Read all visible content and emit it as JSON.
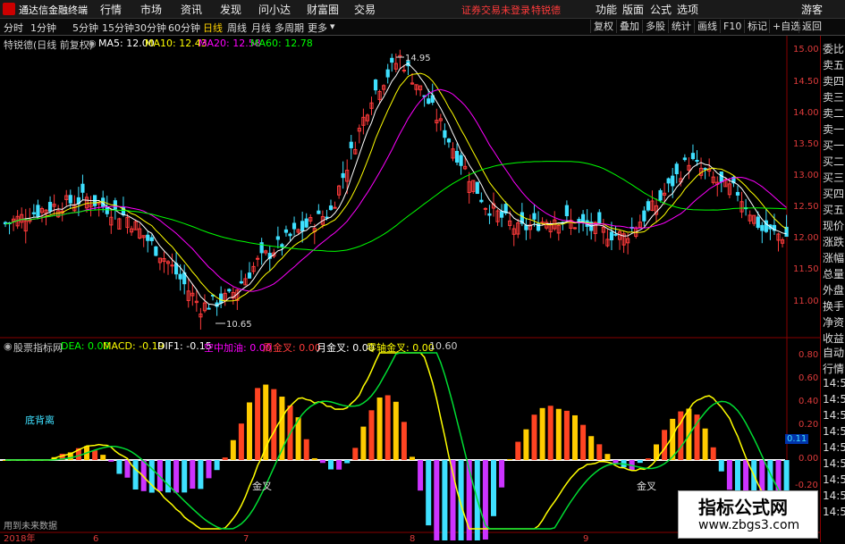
{
  "titlebar": {
    "app_name": "通达信金融终端",
    "menu": [
      "行情",
      "市场",
      "资讯",
      "发现",
      "问小达",
      "财富圈",
      "交易"
    ],
    "login_notice": "证券交易未登录",
    "stock_name": "特锐德",
    "right_menu": [
      "功能",
      "版面",
      "公式",
      "选项"
    ],
    "guest": "游客"
  },
  "tabbar": {
    "periods": [
      "分时",
      "1分钟",
      "5分钟",
      "15分钟",
      "30分钟",
      "60分钟",
      "日线",
      "周线",
      "月线",
      "多周期",
      "更多"
    ],
    "active": "日线",
    "right_buttons": [
      "复权",
      "叠加",
      "多股",
      "统计",
      "画线",
      "F10",
      "标记",
      "+自选",
      "返回"
    ]
  },
  "main_header": {
    "title": "特锐德(日线 前复权)",
    "ma5": "MA5: 12.00",
    "ma10": "MA10: 12.43",
    "ma20": "MA20: 12.58",
    "ma60": "MA60: 12.78"
  },
  "price_axis": [
    "15.00",
    "14.50",
    "14.00",
    "13.50",
    "13.00",
    "12.50",
    "12.00",
    "11.50",
    "11.00"
  ],
  "annotations": {
    "high": "14.95",
    "low": "10.65"
  },
  "indicator_header": {
    "name": "股票指标网",
    "dea": "DEA: 0.00",
    "macd": "MACD: -0.19",
    "dif": "DIF1: -0.15",
    "kz": "空中加油: 0.00",
    "zj": "周金叉: 0.00",
    "yj": "月金叉: 0.00",
    "lj": "零轴金叉: 0.00",
    "extra": "10.60"
  },
  "indicator_axis": [
    "0.80",
    "0.60",
    "0.40",
    "0.20",
    "0.11",
    "0.00",
    "-0.20"
  ],
  "indicator_labels": {
    "divergence": "底背离",
    "cross1": "金叉",
    "cross2": "金叉",
    "future": "用到未来数据"
  },
  "date_axis": {
    "start": "2018年",
    "months": [
      "6",
      "7",
      "8",
      "9"
    ]
  },
  "right_panel": {
    "items": [
      "委比",
      "卖五",
      "卖四",
      "卖三",
      "卖二",
      "卖一",
      "买一",
      "买二",
      "买三",
      "买四",
      "买五",
      "现价",
      "涨跌",
      "涨幅",
      "总量",
      "外盘",
      "换手",
      "净资",
      "收益"
    ],
    "items2": [
      "自动",
      "行情",
      "14:5",
      "14:5",
      "14:5",
      "14:5",
      "14:5",
      "14:5",
      "14:5",
      "14:5",
      "14:5"
    ]
  },
  "watermark": {
    "title": "指标公式网",
    "url": "www.zbgs3.com"
  },
  "colors": {
    "up": "#ff3b3b",
    "down": "#3fe0ff",
    "ma5": "#ffffff",
    "ma10": "#ffff00",
    "ma20": "#ff00ff",
    "ma60": "#00ff00"
  }
}
